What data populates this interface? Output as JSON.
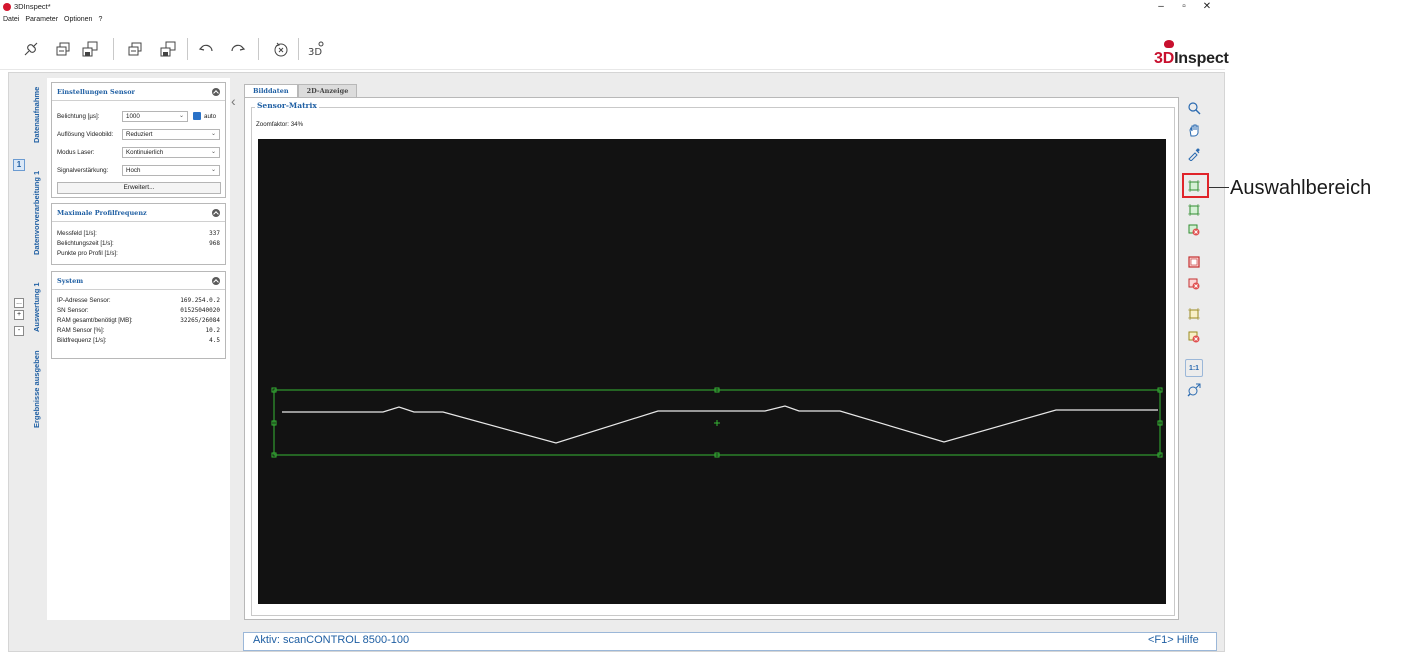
{
  "app": {
    "title": "3DInspect*",
    "brand_prefix": "3D",
    "brand_suffix": "Inspect",
    "brand_color": "#c8102e",
    "accent_color": "#1f5fa3"
  },
  "menu": [
    "Datei",
    "Parameter",
    "Optionen",
    "?"
  ],
  "toolbar": {
    "icons": [
      "connect-icon",
      "load-icon",
      "save-icon",
      "load-alt-icon",
      "save-alt-icon",
      "undo-icon",
      "redo-icon",
      "reset-icon",
      "3d-view-icon"
    ]
  },
  "vertical_tabs": [
    "Datenaufnahme",
    "Datenvorverarbeitung 1",
    "Auswertung 1",
    "Ergebnisse ausgeben"
  ],
  "side_controls": {
    "step_badge": "1",
    "more": "...",
    "plus": "+",
    "minus": "-"
  },
  "sensor_settings": {
    "title": "Einstellungen Sensor",
    "exposure_label": "Belichtung [µs]:",
    "exposure_value": "1000",
    "auto_label": "auto",
    "video_res_label": "Auflösung Videobild:",
    "video_res_value": "Reduziert",
    "laser_mode_label": "Modus Laser:",
    "laser_mode_value": "Kontinuierlich",
    "gain_label": "Signalverstärkung:",
    "gain_value": "Hoch",
    "advanced_button": "Erweitert..."
  },
  "profile_freq": {
    "title": "Maximale Profilfrequenz",
    "rows": [
      {
        "label": "Messfeld [1/s]:",
        "value": "337"
      },
      {
        "label": "Belichtungszeit [1/s]:",
        "value": "968"
      },
      {
        "label": "Punkte pro Profil [1/s]:",
        "value": ""
      }
    ]
  },
  "system": {
    "title": "System",
    "rows": [
      {
        "label": "IP-Adresse Sensor:",
        "value": "169.254.0.2"
      },
      {
        "label": "SN Sensor:",
        "value": "01525040020"
      },
      {
        "label": "RAM gesamt/benötigt [MB]:",
        "value": "32265/26084"
      },
      {
        "label": "RAM Sensor [%]:",
        "value": "10.2"
      },
      {
        "label": "Bildfrequenz [1/s]:",
        "value": "4.5"
      }
    ]
  },
  "view_tabs": [
    "Bilddaten",
    "2D-Anzeige"
  ],
  "sensor_matrix": {
    "title": "Sensor-Matrix",
    "zoom_label": "Zoomfaktor: 34%"
  },
  "right_tools": [
    "zoom-icon",
    "pan-hand-icon",
    "pipette-icon",
    "select-area-icon",
    "select-area-alt-icon",
    "remove-area-icon",
    "frame-icon",
    "remove-frame-icon",
    "crosshair-area-icon",
    "remove-crosshair-icon",
    "1:1",
    "zoom-fit-icon"
  ],
  "callout": "Auswahlbereich",
  "status": {
    "active": "Aktiv: scanCONTROL 8500-100",
    "help": "<F1> Hilfe"
  }
}
